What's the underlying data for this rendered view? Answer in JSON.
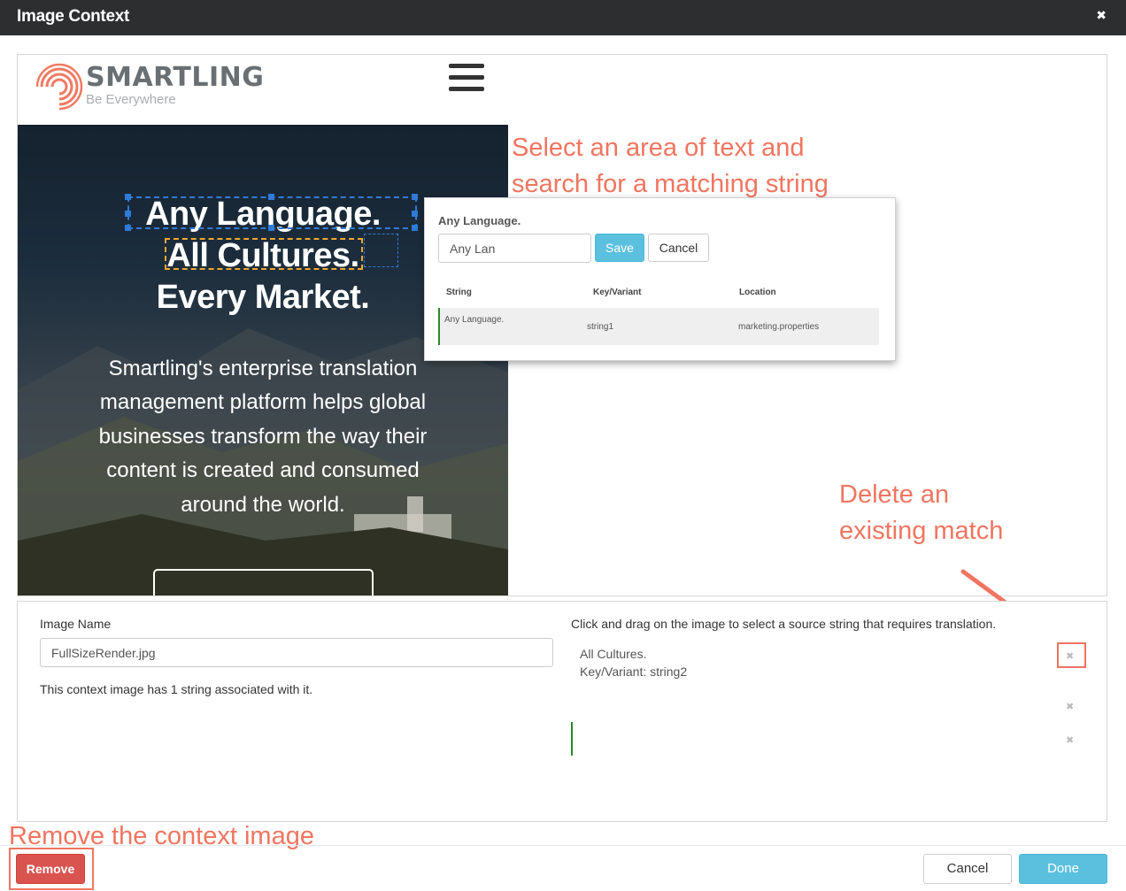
{
  "dialog": {
    "title": "Image Context",
    "close_icon": "close-icon"
  },
  "preview": {
    "logo_word": "SMARTLING",
    "logo_tagline": "Be Everywhere",
    "menu_icon": "hamburger-menu-icon",
    "hero_lines": [
      "Any Language.",
      "All Cultures.",
      "Every Market."
    ],
    "hero_body": [
      "Smartling's enterprise translation",
      "management platform helps global",
      "businesses transform the way their",
      "content is created and consumed",
      "around the world."
    ]
  },
  "popup": {
    "title": "Any Language.",
    "search_value": "Any Lan",
    "save_label": "Save",
    "cancel_label": "Cancel",
    "columns": [
      "String",
      "Key/Variant",
      "Location"
    ],
    "rows": [
      {
        "string": "Any Language.",
        "key": "string1",
        "location": "marketing.properties"
      }
    ]
  },
  "annotations": {
    "select_text": [
      "Select an area of text and",
      "search for a matching string"
    ],
    "delete_match": [
      "Delete an",
      "existing match"
    ],
    "remove_image": "Remove the context image"
  },
  "details": {
    "image_name_label": "Image Name",
    "image_name_value": "FullSizeRender.jpg",
    "string_count_text": "This context image has 1 string associated with it.",
    "instruction": "Click and drag on the image to select a source string that requires translation.",
    "matches": [
      {
        "string": "All Cultures.",
        "key_line": "Key/Variant: string2"
      }
    ],
    "delete_glyph": "✖"
  },
  "footer": {
    "remove_label": "Remove",
    "cancel_label": "Cancel",
    "done_label": "Done"
  },
  "colors": {
    "titlebar": "#2c2e30",
    "annotation": "#f07560",
    "primary": "#5bc0de",
    "danger": "#d9534f",
    "match_indicator": "#2a8a2a",
    "selection_blue": "#2e7bd8",
    "selection_orange": "#f0a830"
  }
}
